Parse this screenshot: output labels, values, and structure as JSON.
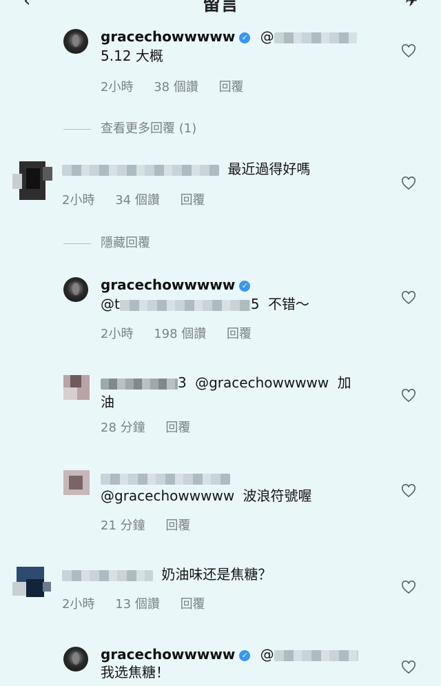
{
  "header": {
    "title": "留言",
    "back_icon": "back-arrow-icon",
    "send_icon": "send-icon"
  },
  "comments": [
    {
      "username": "gracechowwwww",
      "verified": true,
      "mention_prefix": "@",
      "text": "5.12 大概",
      "time": "2小時",
      "likes": "38 個讚",
      "reply": "回覆"
    },
    {
      "text": "最近過得好嗎",
      "time": "2小時",
      "likes": "34 個讚",
      "reply": "回覆"
    },
    {
      "username": "gracechowwwww",
      "verified": true,
      "mention_prefix": "@t",
      "mention_suffix": "5",
      "text": "不错～",
      "time": "2小時",
      "likes": "198 個讚",
      "reply": "回覆"
    },
    {
      "username_suffix": "3",
      "mention": "@gracechowwwww",
      "text_a": "加",
      "text_b": "油",
      "time": "28 分鐘",
      "reply": "回覆"
    },
    {
      "mention": "@gracechowwwww",
      "text": "波浪符號喔",
      "time": "21 分鐘",
      "reply": "回覆"
    },
    {
      "text": "奶油味还是焦糖？",
      "time": "2小時",
      "likes": "13 個讚",
      "reply": "回覆"
    },
    {
      "username": "gracechowwwww",
      "verified": true,
      "mention_prefix": "@",
      "text": "我选焦糖！"
    }
  ],
  "view_more_replies": "查看更多回覆 (1)",
  "hide_replies": "隱藏回覆",
  "colors": {
    "background": "#eaf7f9",
    "verified": "#3897f0",
    "meta": "#7a8286"
  }
}
